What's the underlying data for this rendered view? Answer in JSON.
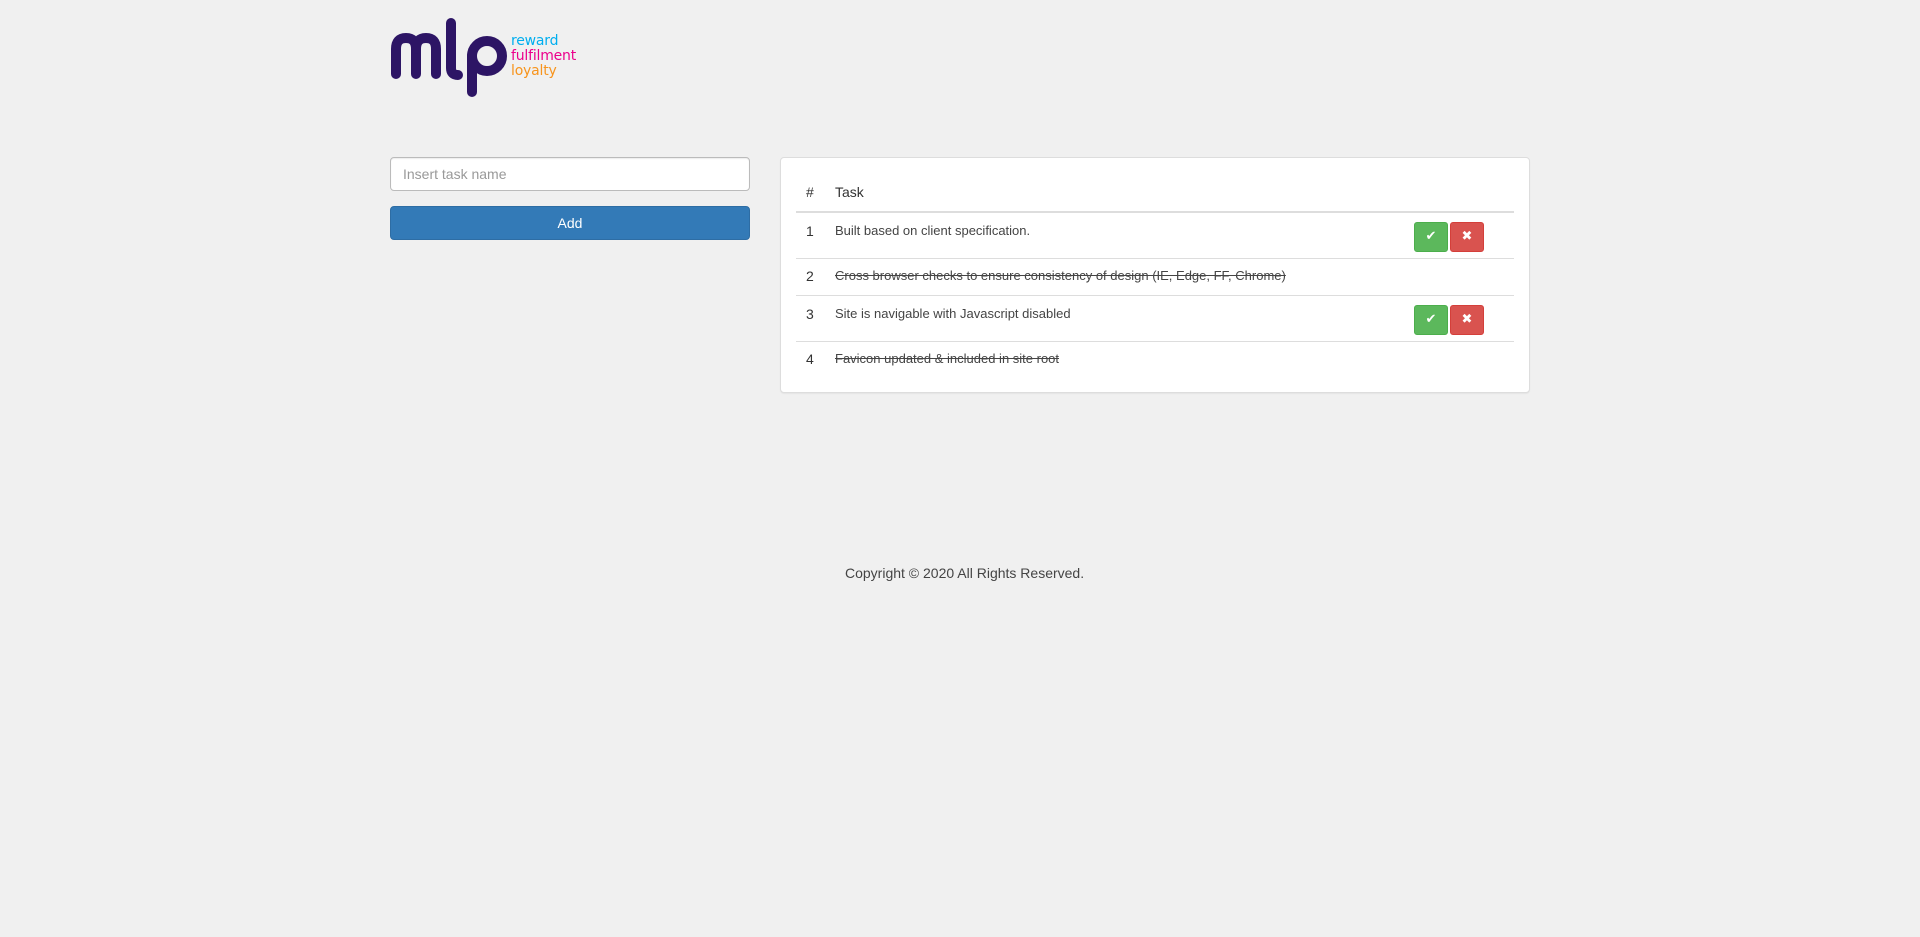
{
  "brand": {
    "logo_text": "mlp",
    "taglines": [
      {
        "text": "reward",
        "color": "#00aeef"
      },
      {
        "text": "fulfilment",
        "color": "#ec008c"
      },
      {
        "text": "loyalty",
        "color": "#f7941d"
      }
    ],
    "mark_color": "#2d1565"
  },
  "form": {
    "input_value": "",
    "input_placeholder": "Insert task name",
    "add_label": "Add",
    "add_color": "#337ab7"
  },
  "table": {
    "headers": {
      "number": "#",
      "task": "Task"
    },
    "rows": [
      {
        "number": "1",
        "task": "Built based on client specification.",
        "completed": false,
        "complete_icon": "check-icon",
        "delete_icon": "times-icon",
        "complete_glyph": "✔",
        "delete_glyph": "✖"
      },
      {
        "number": "2",
        "task": "Cross browser checks to ensure consistency of design (IE, Edge, FF, Chrome)",
        "completed": true
      },
      {
        "number": "3",
        "task": "Site is navigable with Javascript disabled",
        "completed": false,
        "complete_icon": "check-icon",
        "delete_icon": "times-icon",
        "complete_glyph": "✔",
        "delete_glyph": "✖"
      },
      {
        "number": "4",
        "task": "Favicon updated & included in site root",
        "completed": true
      }
    ],
    "complete_color": "#5cb85c",
    "delete_color": "#d9534f"
  },
  "footer": {
    "copyright": "Copyright © 2020 All Rights Reserved."
  }
}
